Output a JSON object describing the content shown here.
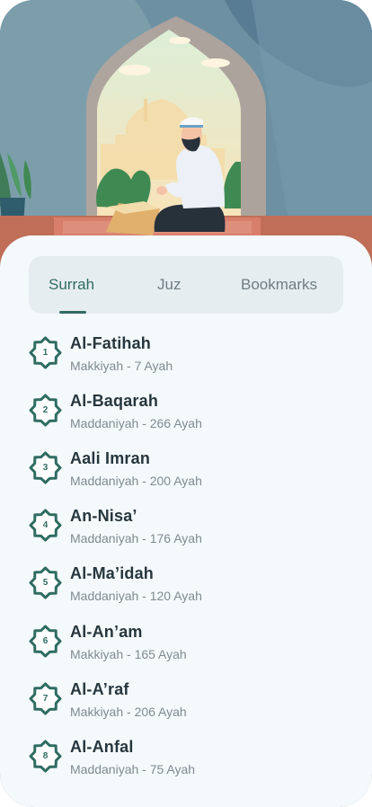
{
  "tabs": [
    {
      "label": "Surrah",
      "active": true
    },
    {
      "label": "Juz",
      "active": false
    },
    {
      "label": "Bookmarks",
      "active": false
    }
  ],
  "surahs": [
    {
      "number": "1",
      "name": "Al-Fatihah",
      "meta": "Makkiyah - 7 Ayah"
    },
    {
      "number": "2",
      "name": "Al-Baqarah",
      "meta": "Maddaniyah - 266 Ayah"
    },
    {
      "number": "3",
      "name": "Aali Imran",
      "meta": "Maddaniyah - 200 Ayah"
    },
    {
      "number": "4",
      "name": "An-Nisa’",
      "meta": "Maddaniyah - 176 Ayah"
    },
    {
      "number": "5",
      "name": "Al-Ma’idah",
      "meta": "Maddaniyah - 120 Ayah"
    },
    {
      "number": "6",
      "name": "Al-An’am",
      "meta": "Makkiyah - 165 Ayah"
    },
    {
      "number": "7",
      "name": "Al-A’raf",
      "meta": "Makkiyah - 206 Ayah"
    },
    {
      "number": "8",
      "name": "Al-Anfal",
      "meta": "Maddaniyah - 75 Ayah"
    }
  ],
  "colors": {
    "accent": "#2f6c62",
    "sheet": "#f4f9fc",
    "tabs_bg": "#e6edf1",
    "sky": "#6f93a5"
  },
  "hero": {
    "illustration": "man-praying-reading-quran"
  }
}
